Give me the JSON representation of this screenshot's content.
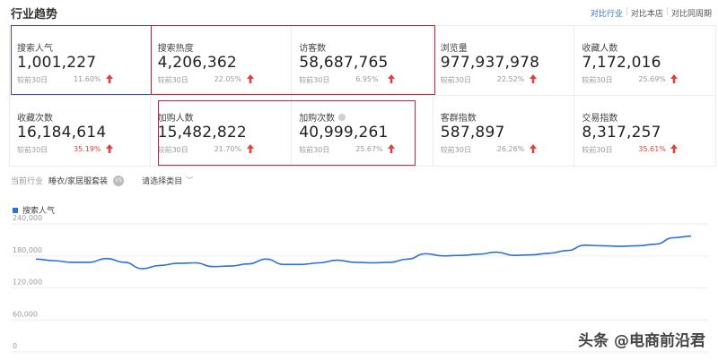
{
  "header": {
    "title": "行业趋势",
    "compare": [
      "对比行业",
      "对比本店",
      "对比同周期"
    ]
  },
  "metrics": [
    [
      {
        "label": "搜索人气",
        "value": "1,001,227",
        "cmp_label": "较前30日",
        "pct": "11.60%",
        "pct_red": false,
        "info": false
      },
      {
        "label": "搜索热度",
        "value": "4,206,362",
        "cmp_label": "较前30日",
        "pct": "22.05%",
        "pct_red": false,
        "info": false
      },
      {
        "label": "访客数",
        "value": "58,687,765",
        "cmp_label": "较前30日",
        "pct": "6.95%",
        "pct_red": false,
        "info": false
      },
      {
        "label": "浏览量",
        "value": "977,937,978",
        "cmp_label": "较前30日",
        "pct": "22.52%",
        "pct_red": false,
        "info": false
      },
      {
        "label": "收藏人数",
        "value": "7,172,016",
        "cmp_label": "较前30日",
        "pct": "25.69%",
        "pct_red": false,
        "info": false
      }
    ],
    [
      {
        "label": "收藏次数",
        "value": "16,184,614",
        "cmp_label": "较前30日",
        "pct": "35.19%",
        "pct_red": true,
        "info": false
      },
      {
        "label": "加购人数",
        "value": "15,482,822",
        "cmp_label": "较前30日",
        "pct": "21.70%",
        "pct_red": false,
        "info": false
      },
      {
        "label": "加购次数",
        "value": "40,999,261",
        "cmp_label": "较前30日",
        "pct": "25.67%",
        "pct_red": false,
        "info": true
      },
      {
        "label": "客群指数",
        "value": "587,897",
        "cmp_label": "较前30日",
        "pct": "26.26%",
        "pct_red": false,
        "info": false
      },
      {
        "label": "交易指数",
        "value": "8,317,257",
        "cmp_label": "较前30日",
        "pct": "35.61%",
        "pct_red": true,
        "info": false
      }
    ]
  ],
  "filter": {
    "label": "当前行业",
    "category": "睡衣/家居服套装",
    "badge": "VS",
    "select": "请选择类目"
  },
  "colors": {
    "accent": "#2e6fd8",
    "up_arrow": "#e0413c",
    "highlight_red": "#c8233c",
    "highlight_blue": "#3c4fa8"
  },
  "chart_data": {
    "type": "line",
    "series": [
      {
        "name": "搜索人气",
        "values": [
          174000,
          171000,
          168000,
          168000,
          175000,
          168000,
          156000,
          162000,
          166000,
          167000,
          160000,
          161000,
          165000,
          174000,
          164000,
          164000,
          167000,
          172000,
          168000,
          167000,
          168000,
          174000,
          184000,
          180000,
          181000,
          183000,
          187000,
          181000,
          182000,
          185000,
          190000,
          200000,
          199000,
          198000,
          199000,
          202000,
          214000,
          217000
        ]
      }
    ],
    "yticks": [
      "0",
      "60,000",
      "120,000",
      "180,000",
      "240,000"
    ],
    "ylim": [
      0,
      240000
    ],
    "grid": true,
    "legend": "top-left"
  },
  "watermark": "头条 @电商前沿君"
}
